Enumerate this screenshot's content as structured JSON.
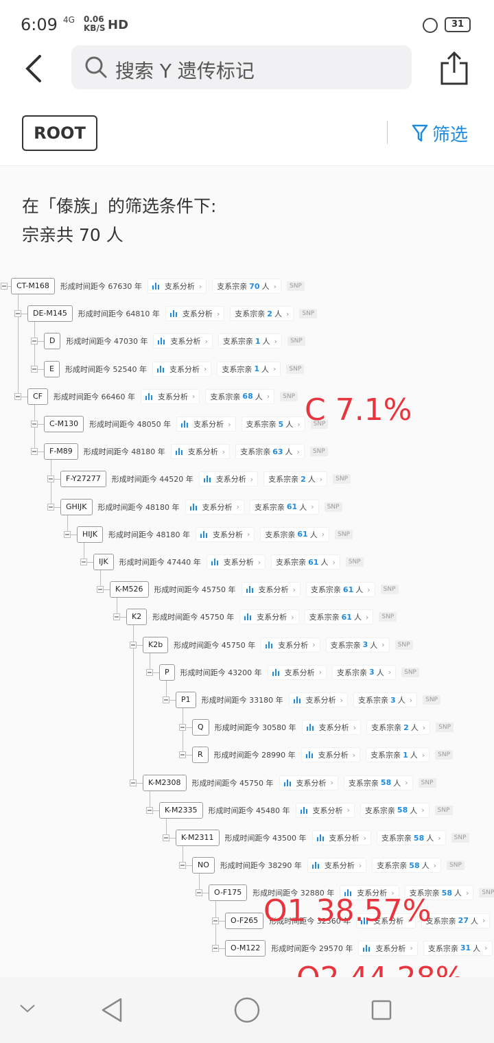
{
  "status": {
    "time": "6:09",
    "network": "4G",
    "speed": "0.06",
    "speed_unit": "KB/S",
    "hd": "HD",
    "battery": "31"
  },
  "search": {
    "placeholder": "搜索 Y 遗传标记"
  },
  "filterbar": {
    "root_label": "ROOT",
    "filter_label": "筛选"
  },
  "condition": {
    "line1": "在「傣族」的筛选条件下:",
    "line2": "宗亲共 70 人"
  },
  "labels": {
    "age_prefix": "形成时间距今",
    "age_suffix": "年",
    "analysis": "支系分析",
    "relatives_prefix": "支系宗亲",
    "relatives_suffix": "人",
    "snp": "SNP"
  },
  "tree": [
    {
      "name": "CT-M168",
      "years": "67630",
      "count": "70",
      "depth": 0
    },
    {
      "name": "DE-M145",
      "years": "64810",
      "count": "2",
      "depth": 1
    },
    {
      "name": "D",
      "years": "47030",
      "count": "1",
      "depth": 2
    },
    {
      "name": "E",
      "years": "52540",
      "count": "1",
      "depth": 2
    },
    {
      "name": "CF",
      "years": "66460",
      "count": "68",
      "depth": 1
    },
    {
      "name": "C-M130",
      "years": "48050",
      "count": "5",
      "depth": 2
    },
    {
      "name": "F-M89",
      "years": "48180",
      "count": "63",
      "depth": 2
    },
    {
      "name": "F-Y27277",
      "years": "44520",
      "count": "2",
      "depth": 3
    },
    {
      "name": "GHIJK",
      "years": "48180",
      "count": "61",
      "depth": 3
    },
    {
      "name": "HIJK",
      "years": "48180",
      "count": "61",
      "depth": 4
    },
    {
      "name": "IJK",
      "years": "47440",
      "count": "61",
      "depth": 5
    },
    {
      "name": "K-M526",
      "years": "45750",
      "count": "61",
      "depth": 6
    },
    {
      "name": "K2",
      "years": "45750",
      "count": "61",
      "depth": 7
    },
    {
      "name": "K2b",
      "years": "45750",
      "count": "3",
      "depth": 8
    },
    {
      "name": "P",
      "years": "43200",
      "count": "3",
      "depth": 9
    },
    {
      "name": "P1",
      "years": "33180",
      "count": "3",
      "depth": 10
    },
    {
      "name": "Q",
      "years": "30580",
      "count": "2",
      "depth": 11
    },
    {
      "name": "R",
      "years": "28990",
      "count": "1",
      "depth": 11
    },
    {
      "name": "K-M2308",
      "years": "45750",
      "count": "58",
      "depth": 8
    },
    {
      "name": "K-M2335",
      "years": "45480",
      "count": "58",
      "depth": 9
    },
    {
      "name": "K-M2311",
      "years": "43500",
      "count": "58",
      "depth": 10
    },
    {
      "name": "NO",
      "years": "38290",
      "count": "58",
      "depth": 11
    },
    {
      "name": "O-F175",
      "years": "32880",
      "count": "58",
      "depth": 12
    },
    {
      "name": "O-F265",
      "years": "32560",
      "count": "27",
      "depth": 13
    },
    {
      "name": "O-M122",
      "years": "29570",
      "count": "31",
      "depth": 13
    }
  ],
  "annotations": {
    "c": "C 7.1%",
    "o1": "O1 38.57%",
    "o2": "O2 44.28%"
  }
}
